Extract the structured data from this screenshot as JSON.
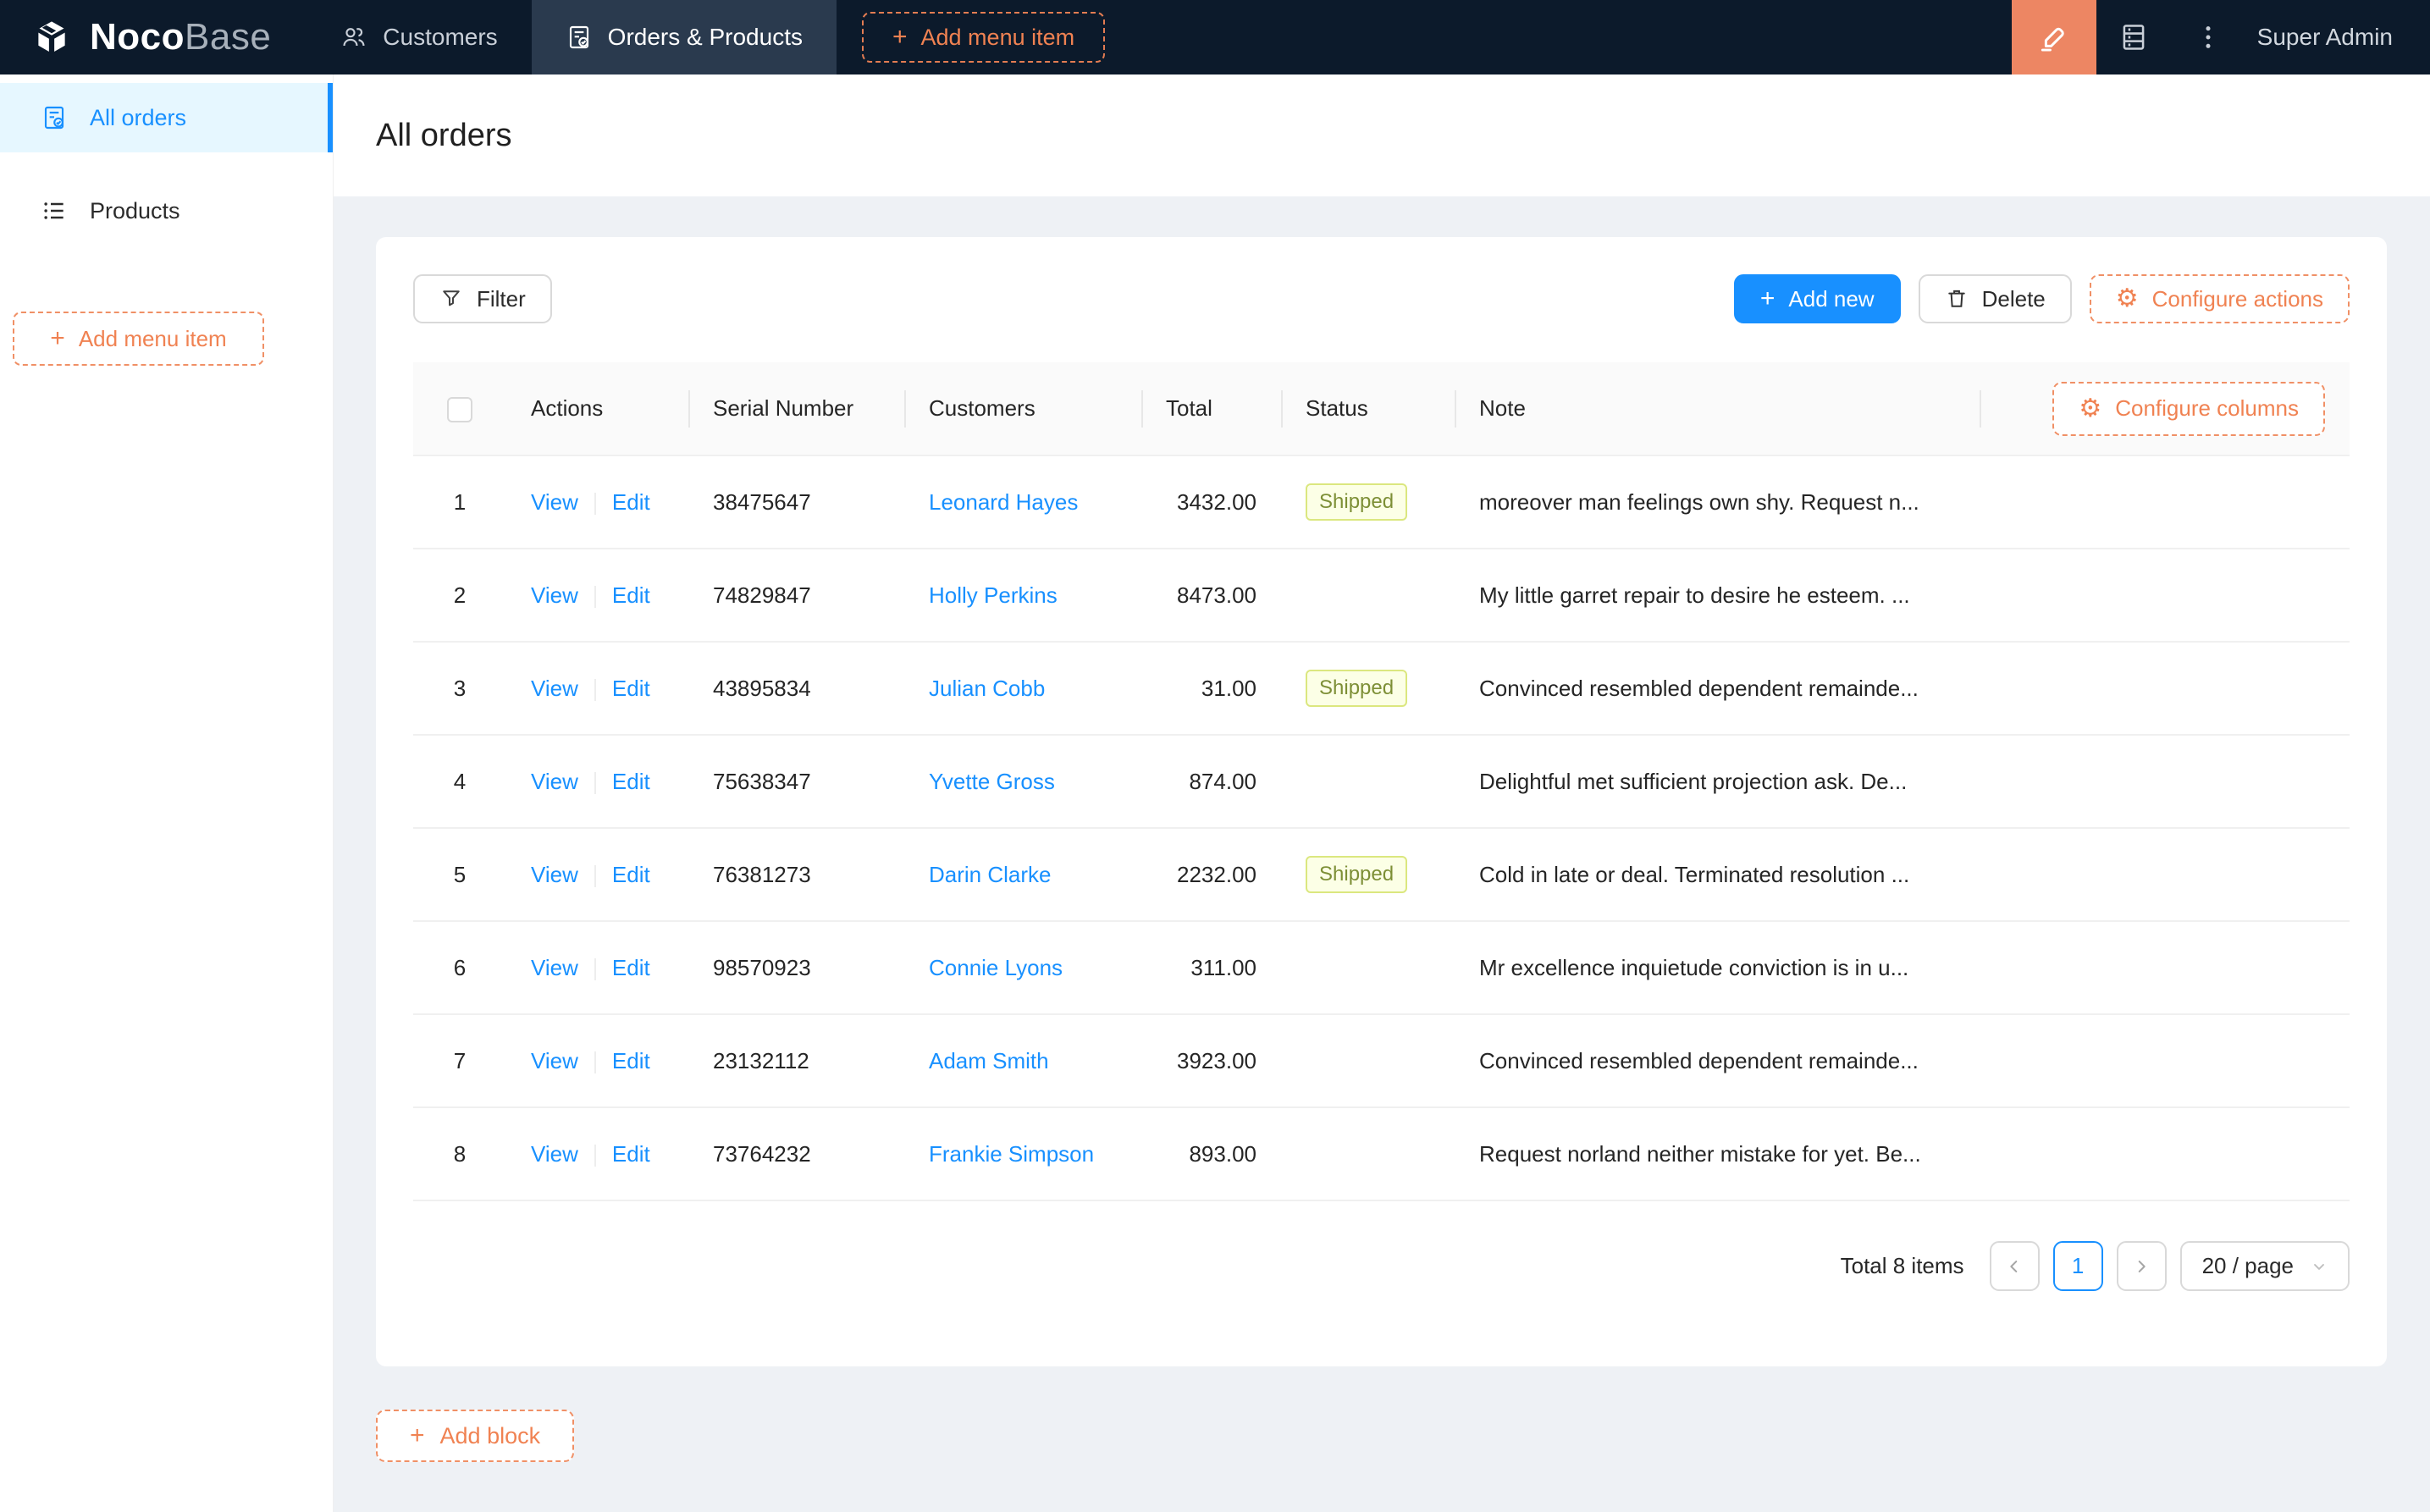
{
  "topbar": {
    "brand_bold": "Noco",
    "brand_light": "Base",
    "tabs": [
      {
        "label": "Customers"
      },
      {
        "label": "Orders & Products"
      }
    ],
    "add_menu_item_label": "Add menu item",
    "user": "Super Admin"
  },
  "sidebar": {
    "items": [
      {
        "label": "All orders"
      },
      {
        "label": "Products"
      }
    ],
    "add_menu_item_label": "Add menu item"
  },
  "page": {
    "title": "All orders"
  },
  "toolbar": {
    "filter_label": "Filter",
    "add_new_label": "Add new",
    "delete_label": "Delete",
    "configure_actions_label": "Configure actions"
  },
  "table": {
    "configure_columns_label": "Configure columns",
    "columns": [
      "Actions",
      "Serial Number",
      "Customers",
      "Total",
      "Status",
      "Note"
    ],
    "action_labels": {
      "view": "View",
      "edit": "Edit"
    },
    "rows": [
      {
        "index": "1",
        "serial": "38475647",
        "customer": "Leonard Hayes",
        "total": "3432.00",
        "status": "Shipped",
        "note": "moreover man feelings own shy. Request n..."
      },
      {
        "index": "2",
        "serial": "74829847",
        "customer": "Holly Perkins",
        "total": "8473.00",
        "status": "",
        "note": "My little garret repair to desire he esteem. ..."
      },
      {
        "index": "3",
        "serial": "43895834",
        "customer": "Julian Cobb",
        "total": "31.00",
        "status": "Shipped",
        "note": "Convinced resembled dependent remainde..."
      },
      {
        "index": "4",
        "serial": "75638347",
        "customer": "Yvette Gross",
        "total": "874.00",
        "status": "",
        "note": "Delightful met sufficient projection ask. De..."
      },
      {
        "index": "5",
        "serial": "76381273",
        "customer": "Darin Clarke",
        "total": "2232.00",
        "status": "Shipped",
        "note": "Cold in late or deal. Terminated resolution ..."
      },
      {
        "index": "6",
        "serial": "98570923",
        "customer": "Connie Lyons",
        "total": "311.00",
        "status": "",
        "note": "Mr excellence inquietude conviction is in u..."
      },
      {
        "index": "7",
        "serial": "23132112",
        "customer": "Adam Smith",
        "total": "3923.00",
        "status": "",
        "note": "Convinced resembled dependent remainde..."
      },
      {
        "index": "8",
        "serial": "73764232",
        "customer": "Frankie Simpson",
        "total": "893.00",
        "status": "",
        "note": "Request norland neither mistake for yet. Be..."
      }
    ]
  },
  "pagination": {
    "total_text": "Total 8 items",
    "current_page": "1",
    "page_size": "20 / page"
  },
  "footer": {
    "add_block_label": "Add block"
  },
  "colors": {
    "topbar_bg": "#0c1a2b",
    "active_tab_bg": "#2a3a4e",
    "accent_orange": "#f08252",
    "design_button_bg": "#ed8663",
    "primary_blue": "#1890ff",
    "sidebar_selected_bg": "#e6f7ff",
    "status_tag_bg": "#fcffe6",
    "status_tag_border": "#dbe77f",
    "status_tag_text": "#7d8f36"
  }
}
